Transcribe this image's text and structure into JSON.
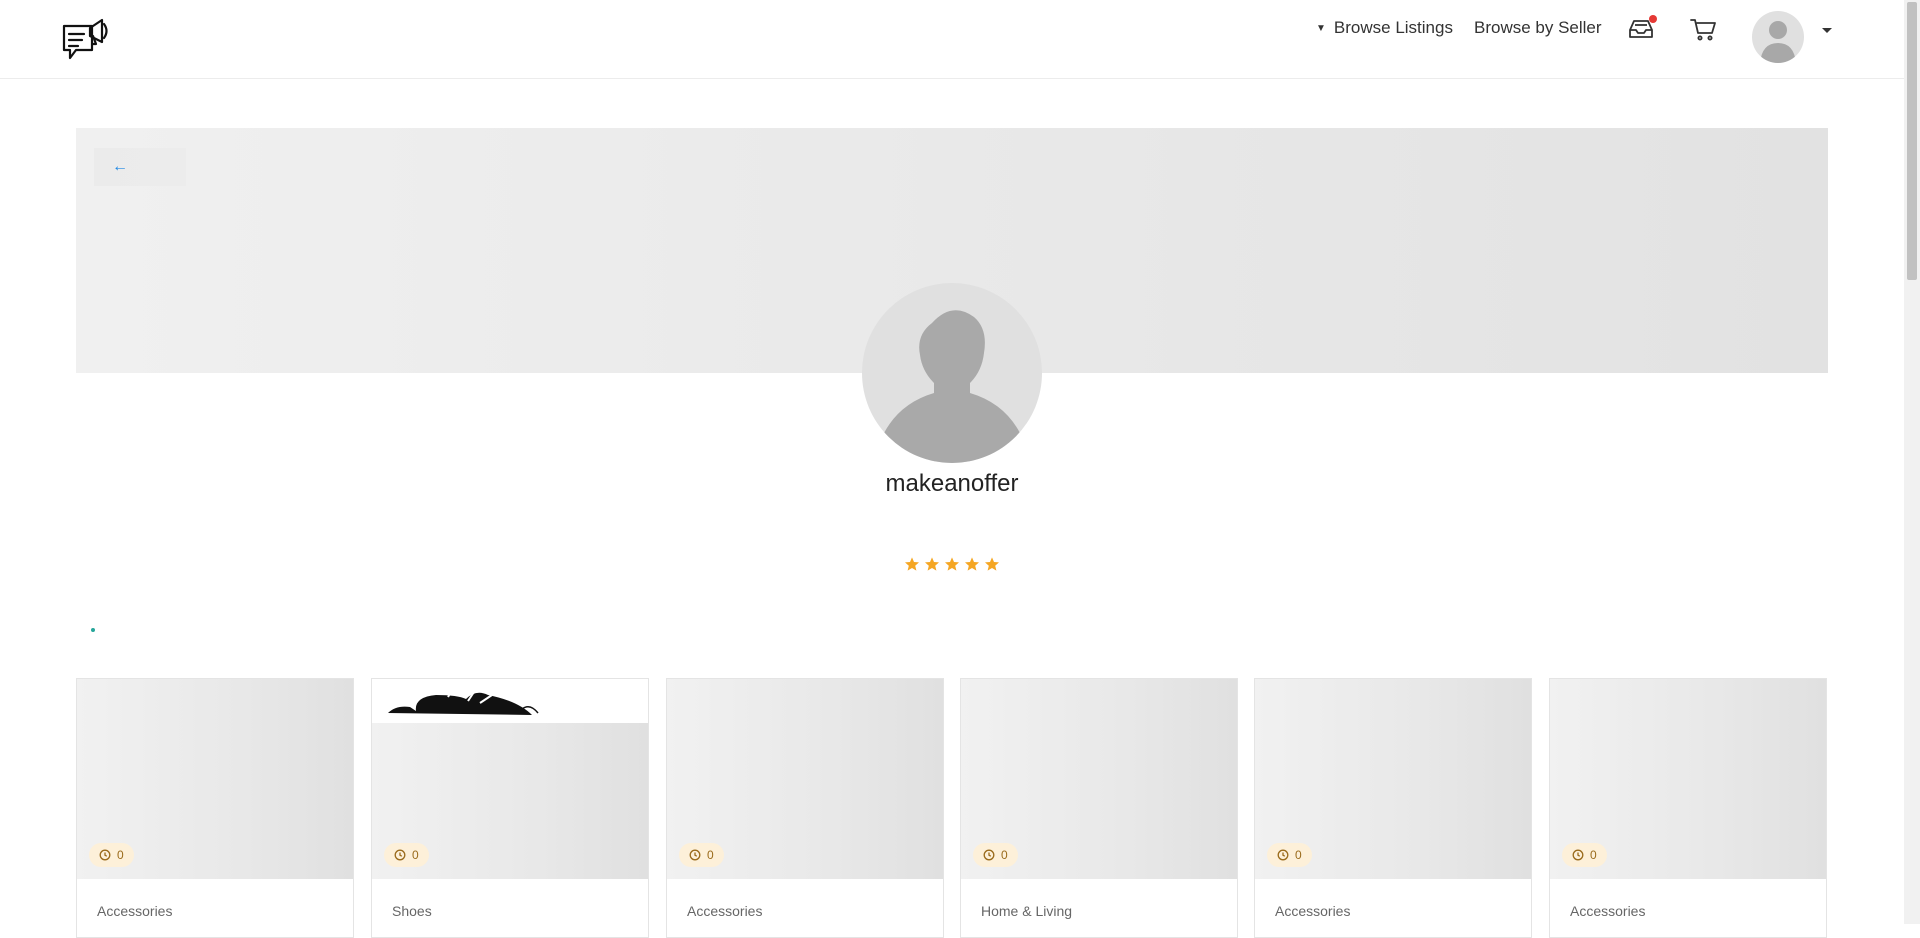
{
  "header": {
    "nav": {
      "browse_listings": "Browse Listings",
      "browse_by_seller": "Browse by Seller"
    },
    "icons": [
      "chat-megaphone-logo-icon",
      "inbox-icon",
      "cart-icon",
      "user-avatar-icon",
      "caret-down-icon"
    ],
    "inbox_has_notification": true
  },
  "banner": {
    "back_label": "←"
  },
  "profile": {
    "username": "makeanoffer",
    "rating_stars": 5,
    "star_color": "#f5a623"
  },
  "listings": [
    {
      "category": "Accessories",
      "count": "0"
    },
    {
      "category": "Shoes",
      "count": "0"
    },
    {
      "category": "Accessories",
      "count": "0"
    },
    {
      "category": "Home & Living",
      "count": "0"
    },
    {
      "category": "Accessories",
      "count": "0"
    },
    {
      "category": "Accessories",
      "count": "0"
    }
  ],
  "colors": {
    "accent_link": "#1e88e5",
    "badge_bg": "#fdf0d9",
    "notification_dot": "#e53935"
  }
}
